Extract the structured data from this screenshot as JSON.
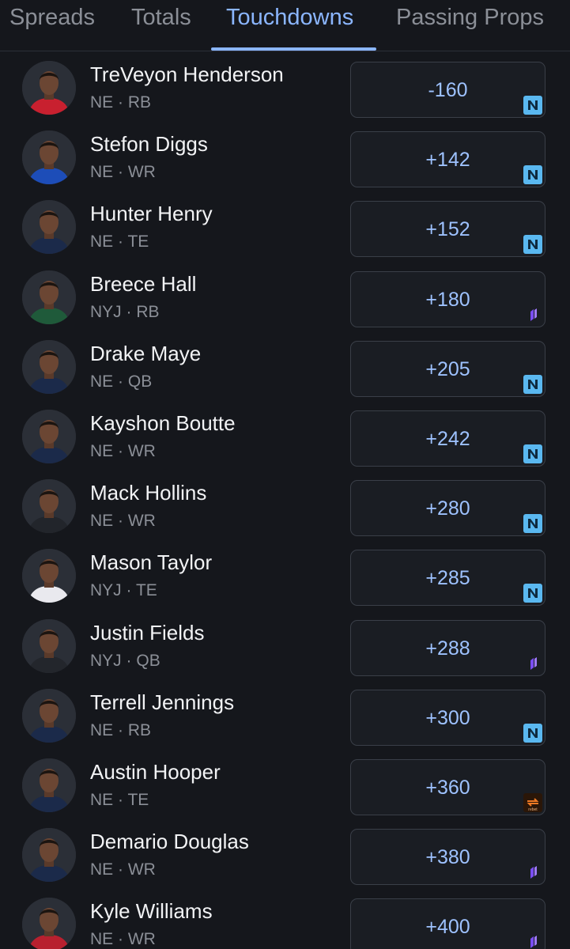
{
  "tabs": [
    {
      "label": "Spreads",
      "active": false
    },
    {
      "label": "Totals",
      "active": false
    },
    {
      "label": "Touchdowns",
      "active": true
    },
    {
      "label": "Passing Props",
      "active": false
    }
  ],
  "colors": {
    "background": "#15171c",
    "accent": "#8bb6ff",
    "odds_text": "#9ec2ff",
    "muted_text": "#8b8f97",
    "book_fanduel_like": "#5ab8f0",
    "book_purple": "#7a4df2",
    "book_orange": "#f07a24"
  },
  "players": [
    {
      "name": "TreVeyon Henderson",
      "team": "NE",
      "position": "RB",
      "odds": "-160",
      "book_icon": "n-book-icon",
      "jersey": "#c8202f"
    },
    {
      "name": "Stefon Diggs",
      "team": "NE",
      "position": "WR",
      "odds": "+142",
      "book_icon": "n-book-icon",
      "jersey": "#1d4db8"
    },
    {
      "name": "Hunter Henry",
      "team": "NE",
      "position": "TE",
      "odds": "+152",
      "book_icon": "n-book-icon",
      "jersey": "#1b2a4a"
    },
    {
      "name": "Breece Hall",
      "team": "NYJ",
      "position": "RB",
      "odds": "+180",
      "book_icon": "purple-book-icon",
      "jersey": "#1f5a3a"
    },
    {
      "name": "Drake Maye",
      "team": "NE",
      "position": "QB",
      "odds": "+205",
      "book_icon": "n-book-icon",
      "jersey": "#1b2a4a"
    },
    {
      "name": "Kayshon Boutte",
      "team": "NE",
      "position": "WR",
      "odds": "+242",
      "book_icon": "n-book-icon",
      "jersey": "#1b2a4a"
    },
    {
      "name": "Mack Hollins",
      "team": "NE",
      "position": "WR",
      "odds": "+280",
      "book_icon": "n-book-icon",
      "jersey": "#22252b"
    },
    {
      "name": "Mason Taylor",
      "team": "NYJ",
      "position": "TE",
      "odds": "+285",
      "book_icon": "n-book-icon",
      "jersey": "#e9e9ee"
    },
    {
      "name": "Justin Fields",
      "team": "NYJ",
      "position": "QB",
      "odds": "+288",
      "book_icon": "purple-book-icon",
      "jersey": "#23262c"
    },
    {
      "name": "Terrell Jennings",
      "team": "NE",
      "position": "RB",
      "odds": "+300",
      "book_icon": "n-book-icon",
      "jersey": "#1b2a4a"
    },
    {
      "name": "Austin Hooper",
      "team": "NE",
      "position": "TE",
      "odds": "+360",
      "book_icon": "rebet-book-icon",
      "jersey": "#1b2a4a"
    },
    {
      "name": "Demario Douglas",
      "team": "NE",
      "position": "WR",
      "odds": "+380",
      "book_icon": "purple-book-icon",
      "jersey": "#1b2a4a"
    },
    {
      "name": "Kyle Williams",
      "team": "NE",
      "position": "WR",
      "odds": "+400",
      "book_icon": "purple-book-icon",
      "jersey": "#b8202f"
    }
  ],
  "book_logo_text": {
    "rebet": "rebet"
  }
}
